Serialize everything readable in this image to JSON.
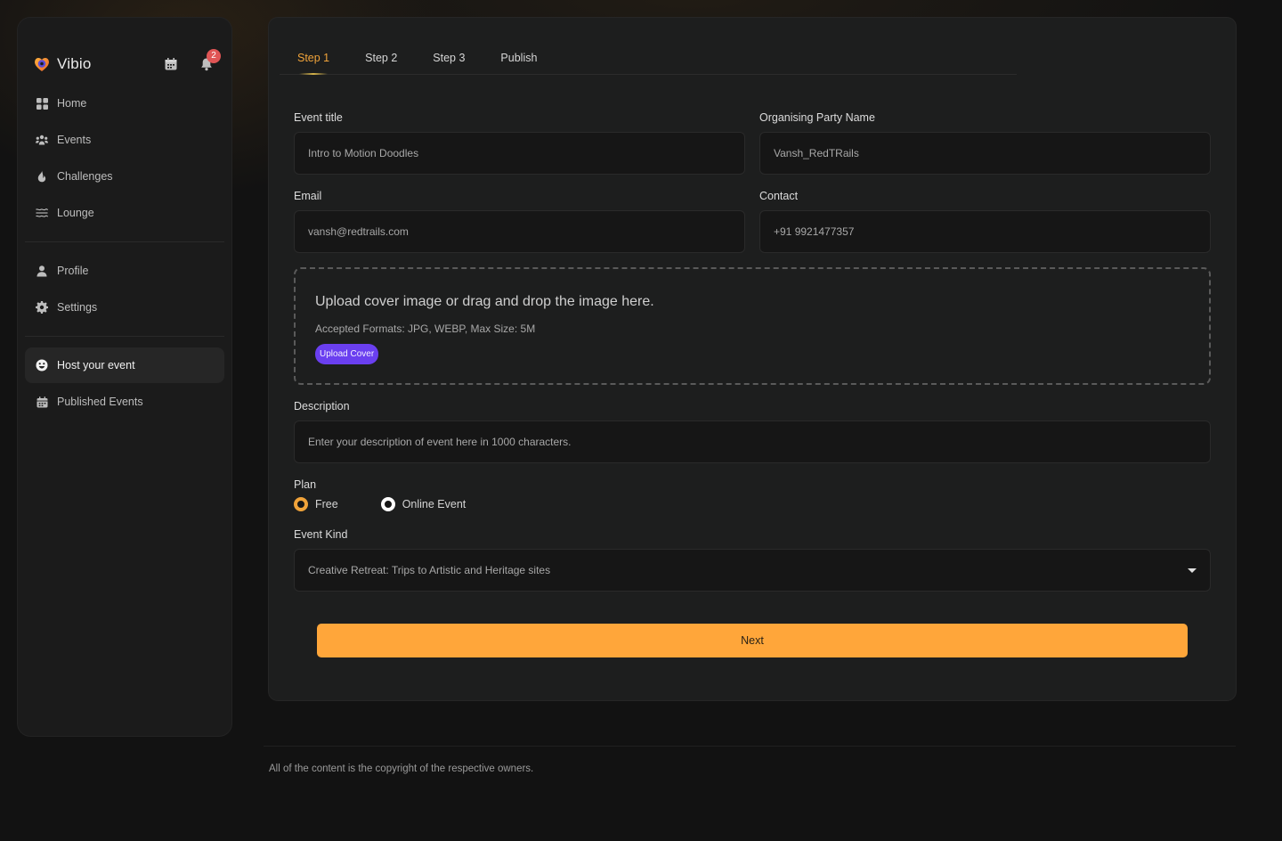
{
  "brand": {
    "name": "Vibio"
  },
  "notifications": {
    "count": "2"
  },
  "sidebar": {
    "main": [
      {
        "label": "Home",
        "icon": "grid-icon"
      },
      {
        "label": "Events",
        "icon": "people-icon"
      },
      {
        "label": "Challenges",
        "icon": "flame-icon"
      },
      {
        "label": "Lounge",
        "icon": "waves-icon"
      }
    ],
    "account": [
      {
        "label": "Profile",
        "icon": "user-icon"
      },
      {
        "label": "Settings",
        "icon": "gear-icon"
      }
    ],
    "host": [
      {
        "label": "Host your event",
        "icon": "host-icon",
        "active": true
      },
      {
        "label": "Published Events",
        "icon": "calendar-icon"
      }
    ]
  },
  "tabs": [
    "Step 1",
    "Step 2",
    "Step 3",
    "Publish"
  ],
  "form": {
    "event_title": {
      "label": "Event title",
      "value": "Intro to Motion Doodles"
    },
    "organiser": {
      "label": "Organising Party Name",
      "value": "Vansh_RedTRails"
    },
    "email": {
      "label": "Email",
      "value": "vansh@redtrails.com"
    },
    "contact": {
      "label": "Contact",
      "value": "+91 9921477357"
    },
    "upload": {
      "title": "Upload cover image or drag and drop the image here.",
      "formats": "Accepted Formats: JPG, WEBP, Max Size: 5M",
      "button": "Upload Cover"
    },
    "description": {
      "label": "Description",
      "placeholder": "Enter your description of event here in 1000 characters."
    },
    "plan": {
      "label": "Plan",
      "options": [
        "Free",
        "Online Event"
      ],
      "selected": "Free"
    },
    "event_kind": {
      "label": "Event Kind",
      "value": "Creative Retreat: Trips to Artistic and Heritage sites"
    },
    "next_label": "Next"
  },
  "footer": {
    "text": "All of the content is the copyright of the respective owners."
  },
  "colors": {
    "accent": "#f0a33a",
    "button": "#ffa63a",
    "upload_button": "#6a3ff0",
    "badge": "#e05555"
  }
}
